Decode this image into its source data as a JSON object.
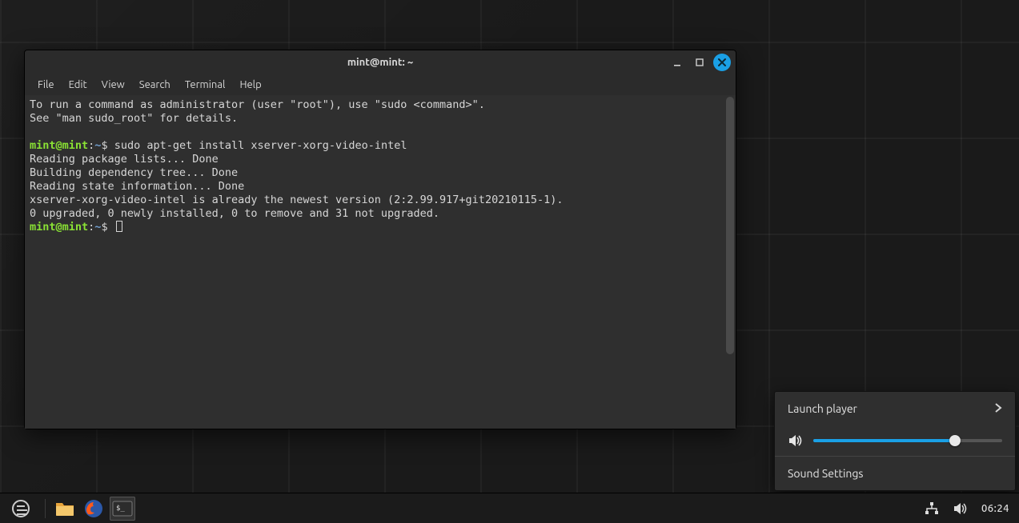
{
  "window": {
    "title": "mint@mint: ~",
    "menubar": [
      "File",
      "Edit",
      "View",
      "Search",
      "Terminal",
      "Help"
    ]
  },
  "terminal": {
    "motd1": "To run a command as administrator (user \"root\"), use \"sudo <command>\".",
    "motd2": "See \"man sudo_root\" for details.",
    "prompt_user": "mint@mint",
    "prompt_sep": ":",
    "prompt_path": "~",
    "prompt_sigil": "$",
    "command": "sudo apt-get install xserver-xorg-video-intel",
    "out1": "Reading package lists... Done",
    "out2": "Building dependency tree... Done",
    "out3": "Reading state information... Done",
    "out4": "xserver-xorg-video-intel is already the newest version (2:2.99.917+git20210115-1).",
    "out5": "0 upgraded, 0 newly installed, 0 to remove and 31 not upgraded."
  },
  "volume_panel": {
    "launch_player": "Launch player",
    "sound_settings": "Sound Settings",
    "level_percent": 75
  },
  "taskbar": {
    "clock": "06:24"
  }
}
